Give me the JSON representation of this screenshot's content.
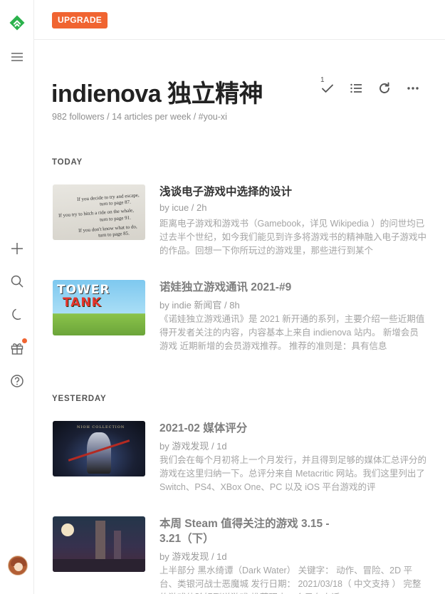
{
  "brand_color": "#2bb24c",
  "accent_color": "#f06431",
  "sidebar": {
    "icons": [
      "feedly-logo-icon",
      "menu-icon",
      "add-icon",
      "search-icon",
      "moon-icon",
      "gift-icon",
      "help-icon"
    ],
    "gift_notification": true
  },
  "topbar": {
    "upgrade_label": "UPGRADE"
  },
  "feed": {
    "title": "indienova 独立精神",
    "meta": "982 followers / 14 articles per week / #you-xi",
    "mark_read_count": "1"
  },
  "sections": [
    {
      "label": "TODAY",
      "articles": [
        {
          "title": "浅谈电子游戏中选择的设计",
          "byline": "by icue / 2h",
          "snippet": "距离电子游戏和游戏书（Gamebook，详见 Wikipedia ）的问世均已过去半个世纪，如今我们能见到许多将游戏书的精神融入电子游戏中的作品。回想一下你所玩过的游戏里，那些进行到某个",
          "thumb_lines": [
            "If you decide to try and escape,",
            "turn to page 87.",
            "If you try to hitch a ride on the whale,",
            "turn to page 91.",
            "If you don't know what to do,",
            "turn to page 85."
          ]
        },
        {
          "title": "诺娃独立游戏通讯 2021-#9",
          "byline": "by indie 新闻官 / 8h",
          "snippet": "《诺娃独立游戏通讯》是 2021 新开通的系列，主要介绍一些近期值得开发者关注的内容，内容基本上来自 indienova 站内。 新增会员游戏 近期新增的会员游戏推荐。 推荐的准则是：具有信息",
          "thumb_lines": [
            "TOWER",
            "TANK"
          ]
        }
      ]
    },
    {
      "label": "YESTERDAY",
      "articles": [
        {
          "title": "2021-02 媒体评分",
          "byline": "by 游戏发现 / 1d",
          "snippet": "我们会在每个月初将上一个月发行，并且得到足够的媒体汇总评分的游戏在这里归纳一下。总评分来自 Metacritic 网站。我们这里列出了 Switch、PS4、XBox One、PC 以及 iOS 平台游戏的评",
          "thumb_lines": [
            "NIOH COLLECTION"
          ]
        },
        {
          "title": "本周 Steam 值得关注的游戏 3.15 - 3.21（下）",
          "byline": "by 游戏发现 / 1d",
          "snippet": "上半部分 黑水绮谭（Dark Water） 关键字： 动作、冒险、2D 平台、类银河战士恶魔城 发行日期： 2021/03/18（ 中文支持 ） 完整的游戏体验好到说游戏 推荐理由一个只有人话",
          "thumb_lines": []
        }
      ]
    }
  ]
}
